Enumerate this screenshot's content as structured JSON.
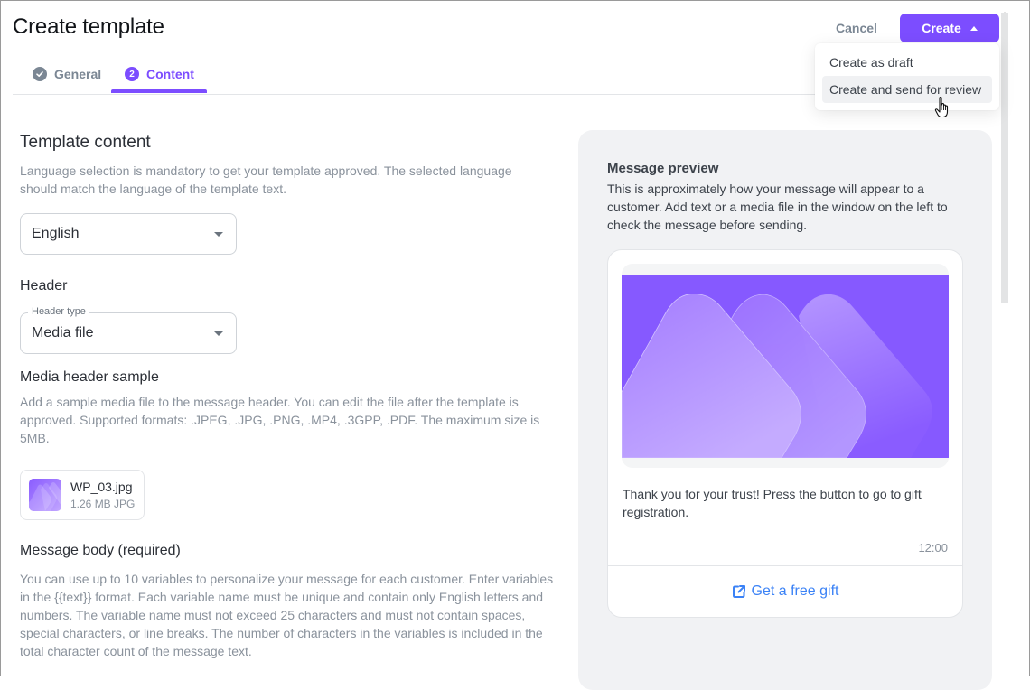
{
  "header": {
    "title": "Create template",
    "cancel_label": "Cancel",
    "create_label": "Create"
  },
  "tabs": [
    {
      "label": "General",
      "icon": "check-circle-icon",
      "state": "completed"
    },
    {
      "label": "Content",
      "badge": "2",
      "state": "active"
    }
  ],
  "create_menu": {
    "items": [
      {
        "label": "Create as draft"
      },
      {
        "label": "Create and send for review",
        "hovered": true
      }
    ]
  },
  "content": {
    "title": "Template content",
    "language_hint": "Language selection is mandatory to get your template approved. The selected language should match the language of the template text.",
    "language_value": "English",
    "header_label": "Header",
    "header_type_label": "Header type",
    "header_type_value": "Media file",
    "media_sample_label": "Media header sample",
    "media_sample_hint": "Add a sample media file to the message header. You can edit the file after the template is approved. Supported formats: .JPEG, .JPG, .PNG, .MP4, .3GPP, .PDF. The maximum size is 5MB.",
    "file": {
      "name": "WP_03.jpg",
      "meta": "1.26 MB JPG"
    },
    "body_label": "Message body (required)",
    "body_hint": "You can use up to 10 variables to personalize your message for each customer. Enter variables in the {{text}} format. Each variable name must be unique and contain only English letters and numbers. The variable name must not exceed 25 characters and must not contain spaces, special characters, or line breaks. The number of characters in the variables is included in the total character count of the message text."
  },
  "preview": {
    "title": "Message preview",
    "description": "This is approximately how your message will appear to a customer. Add text or a media file in the window on the left to check the message before sending.",
    "message_text": "Thank you for your trust! Press the button to go to gift registration.",
    "time": "12:00",
    "action_label": "Get a free gift",
    "action_icon": "external-link-icon"
  },
  "colors": {
    "accent": "#7c4dff",
    "link": "#3b82f6",
    "muted": "#8a929c",
    "panel_bg": "#f1f2f4"
  }
}
